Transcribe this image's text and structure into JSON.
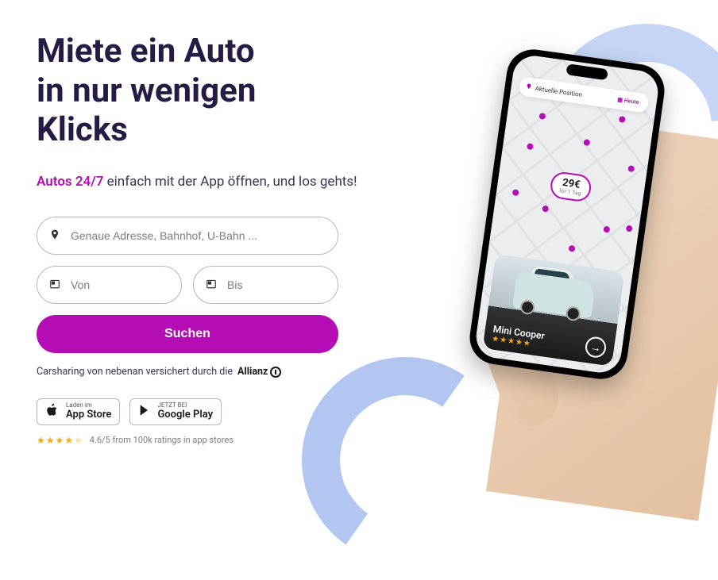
{
  "hero": {
    "title": "Miete ein Auto\nin nur wenigen\nKlicks",
    "subtitle_highlight": "Autos 24/7",
    "subtitle_rest": " einfach mit der App öffnen, und los gehts!"
  },
  "search": {
    "address_placeholder": "Genaue Adresse, Bahnhof, U-Bahn ...",
    "from_placeholder": "Von",
    "to_placeholder": "Bis",
    "button_label": "Suchen"
  },
  "insurance": {
    "text": "Carsharing von nebenan versichert durch die",
    "brand": "Allianz"
  },
  "store": {
    "apple_small": "Laden im",
    "apple_big": "App Store",
    "google_small": "JETZT BEI",
    "google_big": "Google Play"
  },
  "rating": {
    "text": "4.6/5 from 100k ratings in app stores"
  },
  "phone": {
    "topbar_label": "Aktuelle Position",
    "topbar_chip": "Heute",
    "price_main": "29€",
    "price_sub": "für 1 Tag",
    "car_name": "Mini Cooper"
  }
}
